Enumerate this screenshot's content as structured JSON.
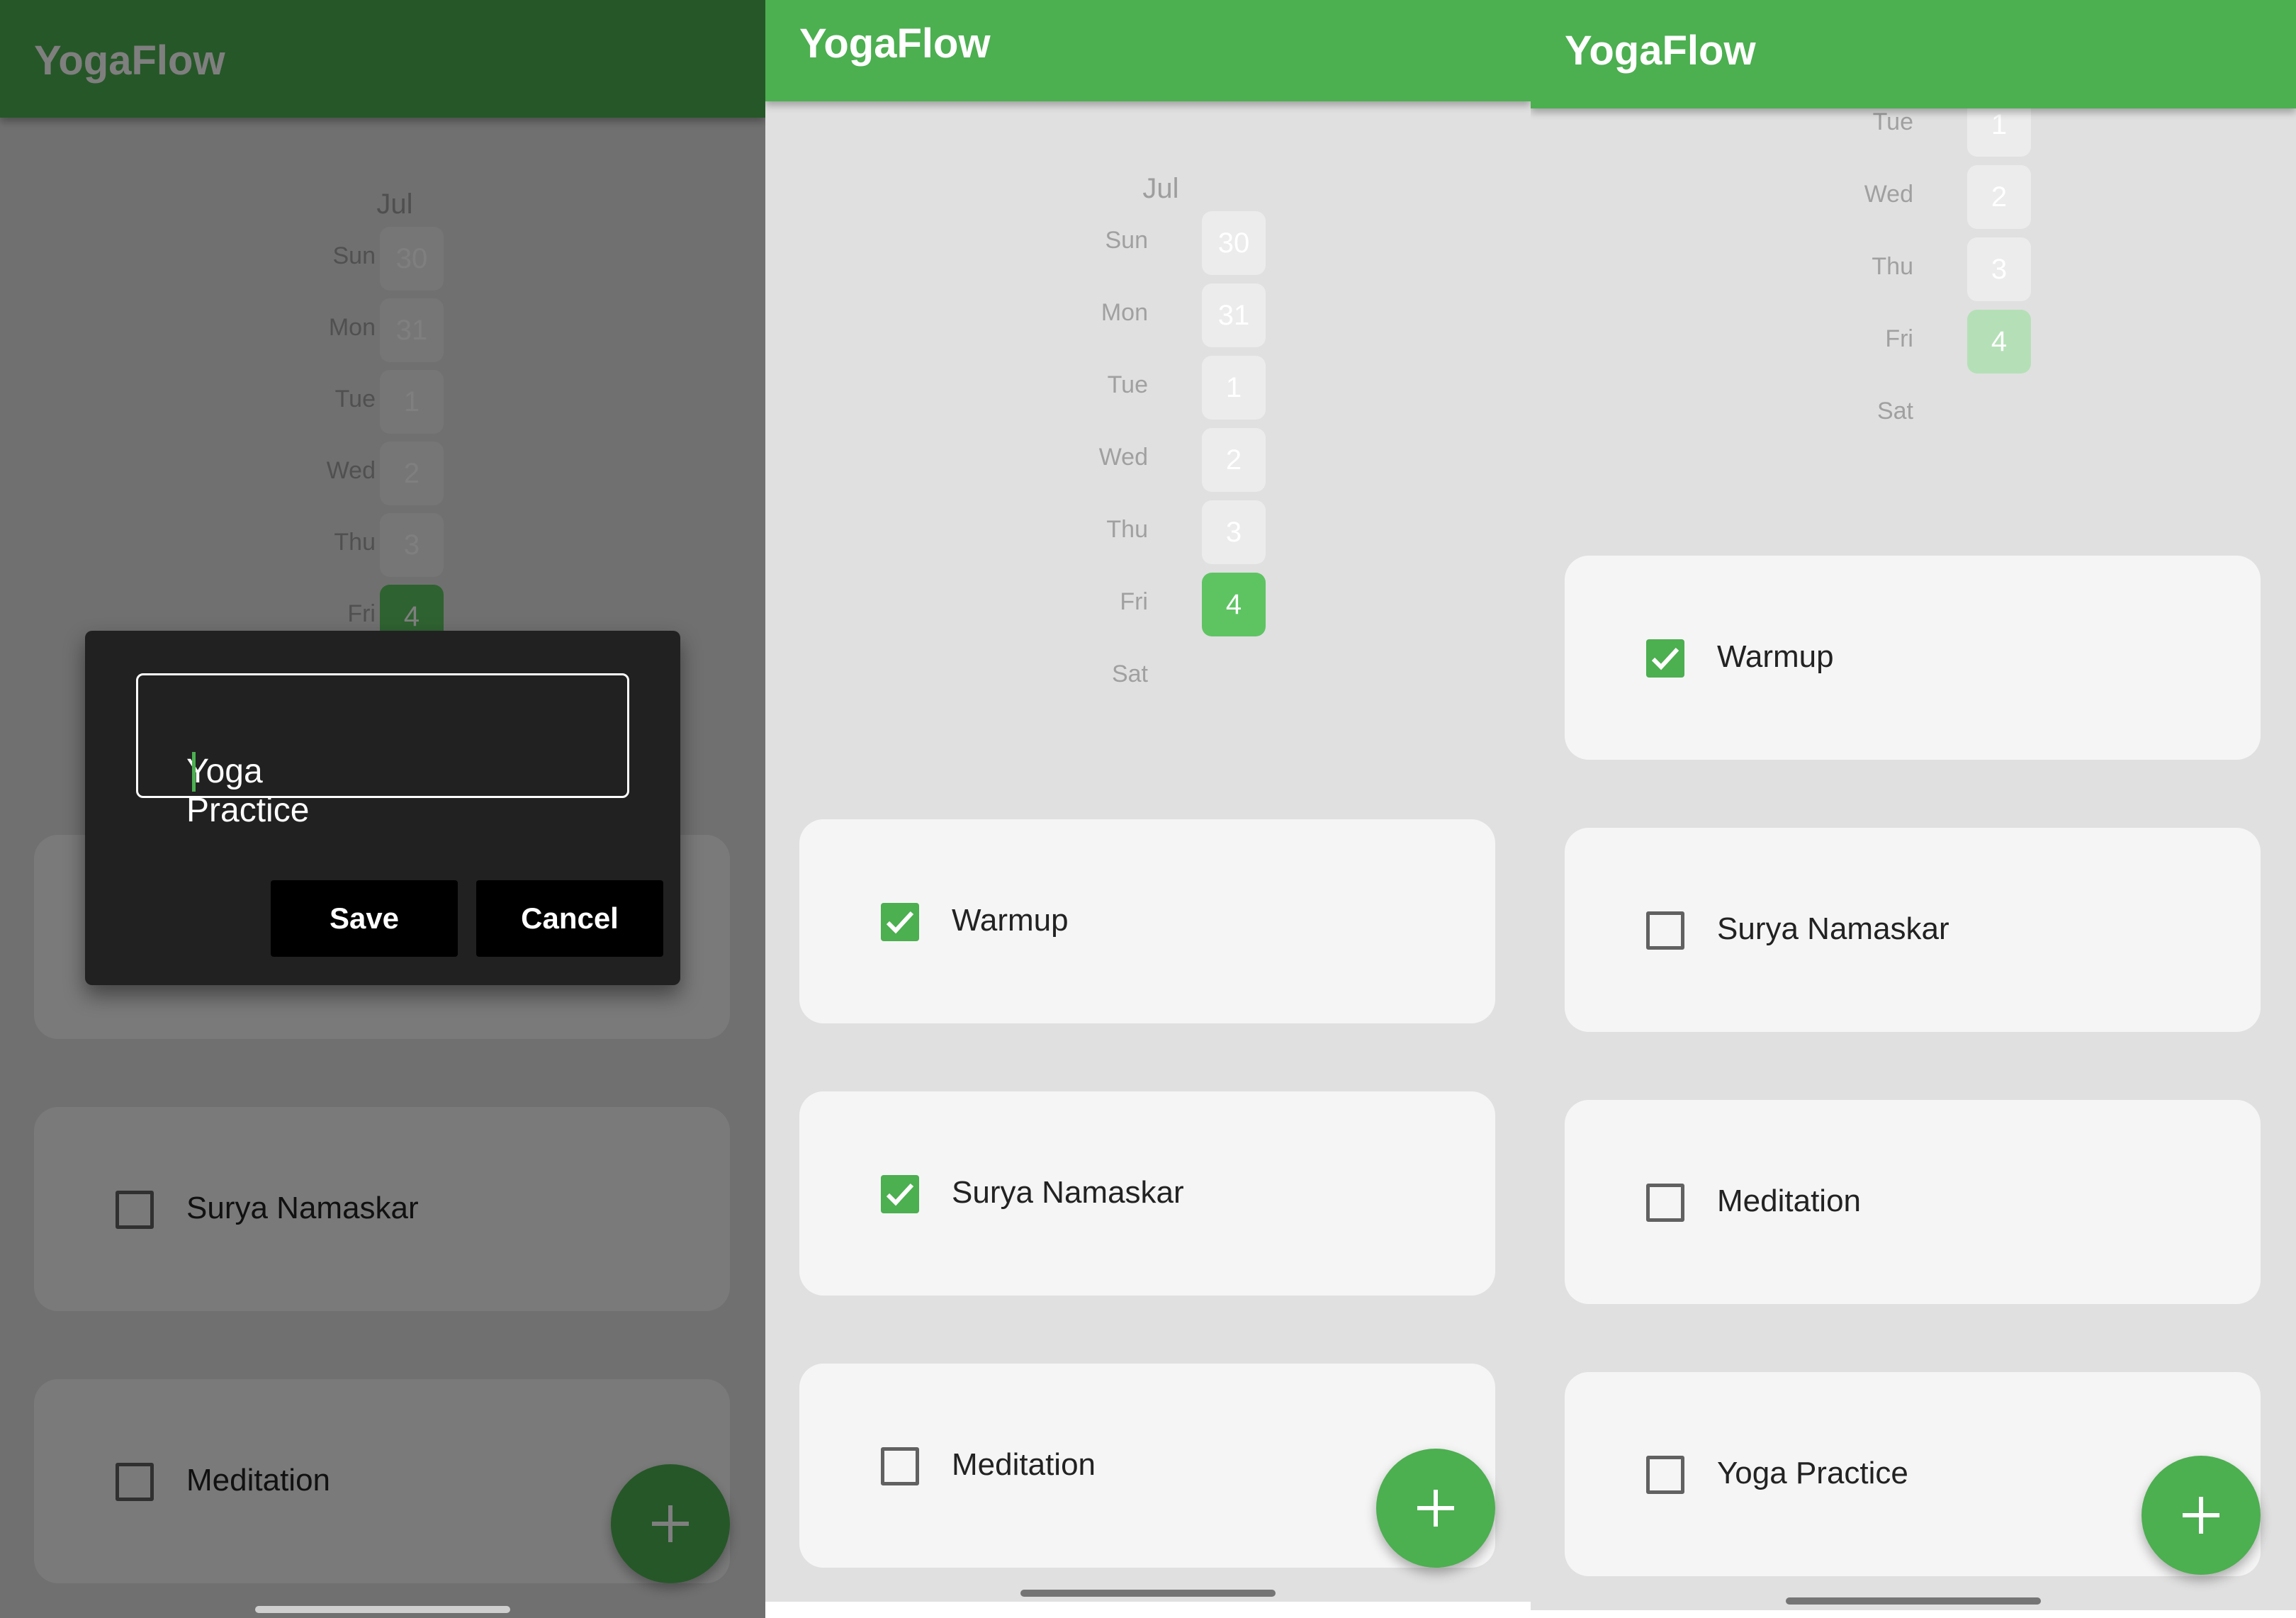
{
  "app_title": "YogaFlow",
  "calendar": {
    "month": "Jul",
    "days": [
      {
        "name": "Sun",
        "num": "30"
      },
      {
        "name": "Mon",
        "num": "31"
      },
      {
        "name": "Tue",
        "num": "1"
      },
      {
        "name": "Wed",
        "num": "2"
      },
      {
        "name": "Thu",
        "num": "3"
      },
      {
        "name": "Fri",
        "num": "4"
      },
      {
        "name": "Sat",
        "num": ""
      }
    ],
    "selected_day": "4"
  },
  "screens": [
    {
      "state": "add-task dialog open",
      "tasks": [
        {
          "label": "Surya Namaskar",
          "checked": false
        },
        {
          "label": "Meditation",
          "checked": false
        }
      ],
      "dialog": {
        "input_value": "Yoga Practice",
        "save_label": "Save",
        "cancel_label": "Cancel"
      }
    },
    {
      "state": "task list",
      "tasks": [
        {
          "label": "Warmup",
          "checked": true
        },
        {
          "label": "Surya Namaskar",
          "checked": true
        },
        {
          "label": "Meditation",
          "checked": false
        }
      ]
    },
    {
      "state": "task list after adding",
      "tasks": [
        {
          "label": "Warmup",
          "checked": true
        },
        {
          "label": "Surya Namaskar",
          "checked": false
        },
        {
          "label": "Meditation",
          "checked": false
        },
        {
          "label": "Yoga Practice",
          "checked": false
        }
      ]
    }
  ],
  "icons": {
    "fab": "plus-icon",
    "checkbox_checked": "check-icon"
  },
  "colors": {
    "primary": "#4caf50",
    "selected_day": "#5ec462",
    "background": "#e0e0e0",
    "card": "#f5f5f5",
    "dialog": "#212121"
  }
}
